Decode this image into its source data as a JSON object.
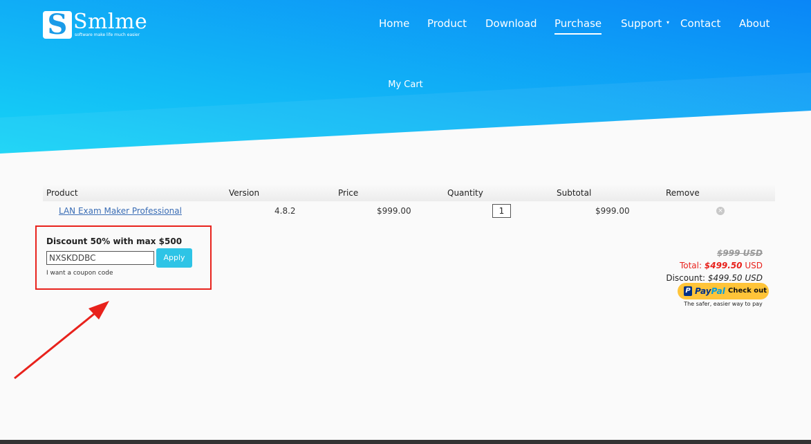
{
  "brand": {
    "name": "Smlme",
    "mark": "S",
    "tagline": "software make life much easier"
  },
  "nav": {
    "home": "Home",
    "product": "Product",
    "download": "Download",
    "purchase": "Purchase",
    "support": "Support",
    "contact": "Contact",
    "about": "About",
    "caret": "▾",
    "active": "purchase"
  },
  "page_title": "My Cart",
  "table": {
    "headers": [
      "Product",
      "Version",
      "Price",
      "Quantity",
      "Subtotal",
      "Remove"
    ],
    "rows": [
      {
        "product": "LAN Exam Maker Professional",
        "version": "4.8.2",
        "price": "$999.00",
        "quantity": "1",
        "subtotal": "$999.00",
        "remove": "×"
      }
    ]
  },
  "coupon": {
    "title": "Discount 50% with max $500",
    "code": "NXSKDDBC",
    "apply_label": "Apply",
    "link": "I want a coupon code"
  },
  "totals": {
    "original": "$999 USD",
    "total_label": "Total:",
    "total_value": "$499.50",
    "total_unit": "USD",
    "discount_label": "Discount:",
    "discount_value": "$499.50 USD"
  },
  "paypal": {
    "icon": "P",
    "brand_pay": "Pay",
    "brand_pal": "Pal",
    "label": "Check out",
    "tagline": "The safer, easier way to pay"
  },
  "colors": {
    "hero_start": "#16d4f6",
    "hero_end": "#0a86f7",
    "highlight": "#e8221c",
    "apply": "#2ec4e6",
    "paypal": "#ffc439"
  }
}
